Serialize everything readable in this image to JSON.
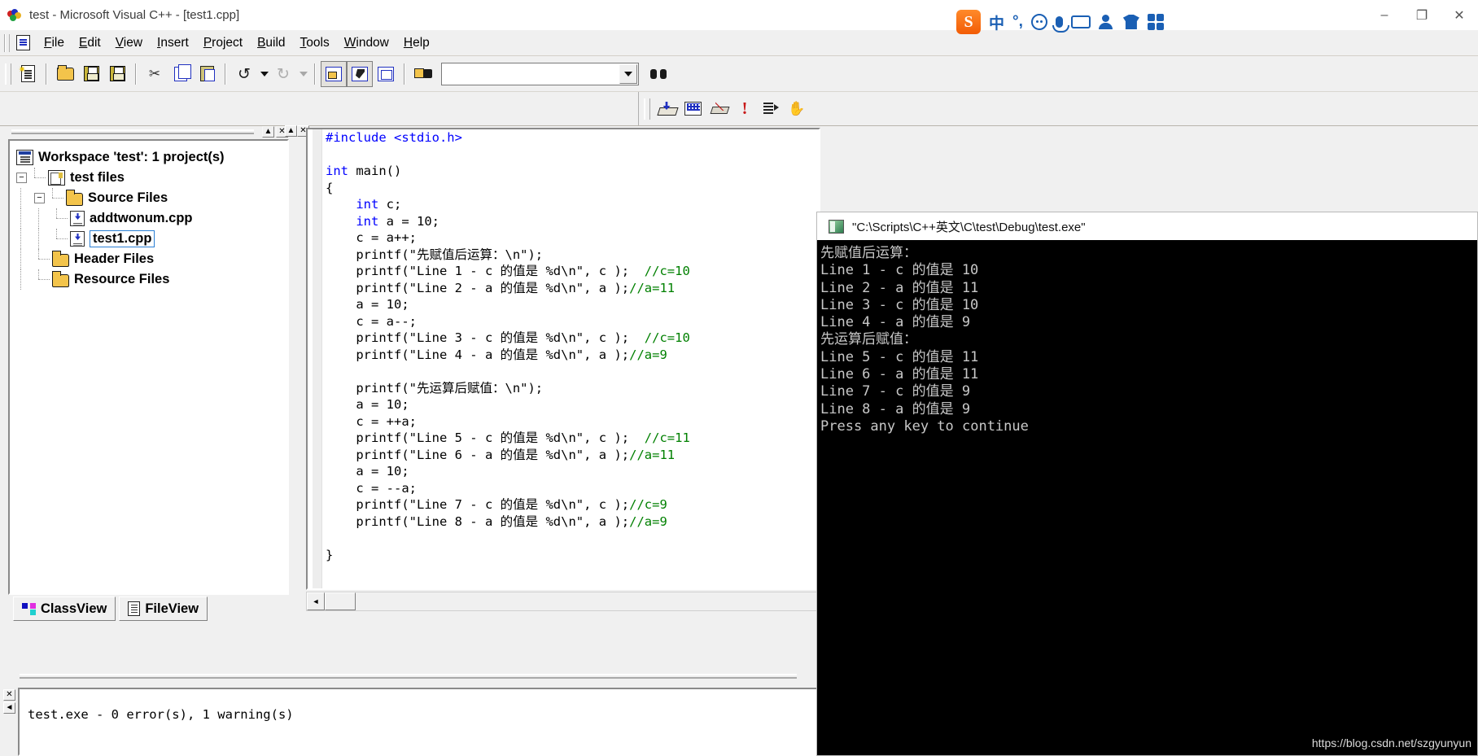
{
  "window": {
    "title": "test - Microsoft Visual C++ - [test1.cpp]",
    "app_icon": "vcpp-logo-icon",
    "minimize": "–",
    "maximize": "❐",
    "close": "✕"
  },
  "ime": {
    "logo": "sogou-ime-logo",
    "lang": "中",
    "punct": "°,",
    "emoji": "emoji-icon",
    "mic": "microphone-icon",
    "keyboard": "keyboard-icon",
    "account": "account-icon",
    "skin": "skin-icon",
    "toolbox": "toolbox-icon"
  },
  "menu": {
    "doc_icon": "document-icon",
    "items": [
      {
        "pre": "",
        "key": "F",
        "post": "ile"
      },
      {
        "pre": "",
        "key": "E",
        "post": "dit"
      },
      {
        "pre": "",
        "key": "V",
        "post": "iew"
      },
      {
        "pre": "",
        "key": "I",
        "post": "nsert"
      },
      {
        "pre": "",
        "key": "P",
        "post": "roject"
      },
      {
        "pre": "",
        "key": "B",
        "post": "uild"
      },
      {
        "pre": "",
        "key": "T",
        "post": "ools"
      },
      {
        "pre": "",
        "key": "W",
        "post": "indow"
      },
      {
        "pre": "",
        "key": "H",
        "post": "elp"
      }
    ]
  },
  "toolbar_standard": {
    "buttons": [
      "new-document-icon",
      "open-folder-icon",
      "save-icon",
      "save-all-icon",
      "cut-scissors-icon",
      "copy-icon",
      "paste-icon",
      "undo-icon",
      "undo-dropdown-icon",
      "redo-icon",
      "redo-dropdown-icon",
      "workspace-window-icon",
      "output-window-icon",
      "resource-window-icon",
      "find-in-files-icon"
    ],
    "find_combo_value": "",
    "find_combo_placeholder": ""
  },
  "toolbar_build": {
    "buttons": [
      "compile-icon",
      "build-icon",
      "stop-build-icon",
      "execute-program-icon",
      "go-debug-icon",
      "insert-breakpoint-icon"
    ]
  },
  "workspace": {
    "caption_restore": "▲",
    "caption_close": "✕",
    "tree": [
      {
        "level": 0,
        "expander": "",
        "icon": "workspace-icon",
        "label": "Workspace 'test': 1 project(s)",
        "selected": false
      },
      {
        "level": 1,
        "expander": "−",
        "icon": "project-icon",
        "label": "test files",
        "selected": false
      },
      {
        "level": 2,
        "expander": "−",
        "icon": "folder-icon",
        "label": "Source Files",
        "selected": false
      },
      {
        "level": 3,
        "expander": "",
        "icon": "cpp-file-icon",
        "label": "addtwonum.cpp",
        "selected": false
      },
      {
        "level": 3,
        "expander": "",
        "icon": "cpp-file-icon",
        "label": "test1.cpp",
        "selected": true
      },
      {
        "level": 2,
        "expander": "",
        "icon": "folder-icon",
        "label": "Header Files",
        "selected": false
      },
      {
        "level": 2,
        "expander": "",
        "icon": "folder-icon",
        "label": "Resource Files",
        "selected": false
      }
    ],
    "tabs": [
      {
        "icon": "class-view-icon",
        "label": "ClassView",
        "active": false
      },
      {
        "icon": "file-view-icon",
        "label": "FileView",
        "active": true
      }
    ]
  },
  "editor": {
    "caption_restore": "▲",
    "caption_close": "✕",
    "scroll_left": "◄",
    "scroll_right": "►",
    "code_lines": [
      [
        {
          "t": "#include <stdio.h>",
          "c": "kw"
        }
      ],
      [],
      [
        {
          "t": "int",
          "c": "kw"
        },
        {
          "t": " main()",
          "c": ""
        }
      ],
      [
        {
          "t": "{",
          "c": ""
        }
      ],
      [
        {
          "t": "    ",
          "c": ""
        },
        {
          "t": "int",
          "c": "kw"
        },
        {
          "t": " c;",
          "c": ""
        }
      ],
      [
        {
          "t": "    ",
          "c": ""
        },
        {
          "t": "int",
          "c": "kw"
        },
        {
          "t": " a = 10;",
          "c": ""
        }
      ],
      [
        {
          "t": "    c = a++;",
          "c": ""
        }
      ],
      [
        {
          "t": "    printf(\"先赋值后运算：\\n\");",
          "c": ""
        }
      ],
      [
        {
          "t": "    printf(\"Line 1 - c 的值是 %d\\n\", c );  ",
          "c": ""
        },
        {
          "t": "//c=10",
          "c": "cm"
        }
      ],
      [
        {
          "t": "    printf(\"Line 2 - a 的值是 %d\\n\", a );",
          "c": ""
        },
        {
          "t": "//a=11",
          "c": "cm"
        }
      ],
      [
        {
          "t": "    a = 10;",
          "c": ""
        }
      ],
      [
        {
          "t": "    c = a--;",
          "c": ""
        }
      ],
      [
        {
          "t": "    printf(\"Line 3 - c 的值是 %d\\n\", c );  ",
          "c": ""
        },
        {
          "t": "//c=10",
          "c": "cm"
        }
      ],
      [
        {
          "t": "    printf(\"Line 4 - a 的值是 %d\\n\", a );",
          "c": ""
        },
        {
          "t": "//a=9",
          "c": "cm"
        }
      ],
      [],
      [
        {
          "t": "    printf(\"先运算后赋值：\\n\");",
          "c": ""
        }
      ],
      [
        {
          "t": "    a = 10;",
          "c": ""
        }
      ],
      [
        {
          "t": "    c = ++a;",
          "c": ""
        }
      ],
      [
        {
          "t": "    printf(\"Line 5 - c 的值是 %d\\n\", c );  ",
          "c": ""
        },
        {
          "t": "//c=11",
          "c": "cm"
        }
      ],
      [
        {
          "t": "    printf(\"Line 6 - a 的值是 %d\\n\", a );",
          "c": ""
        },
        {
          "t": "//a=11",
          "c": "cm"
        }
      ],
      [
        {
          "t": "    a = 10;",
          "c": ""
        }
      ],
      [
        {
          "t": "    c = --a;",
          "c": ""
        }
      ],
      [
        {
          "t": "    printf(\"Line 7 - c 的值是 %d\\n\", c );",
          "c": ""
        },
        {
          "t": "//c=9",
          "c": "cm"
        }
      ],
      [
        {
          "t": "    printf(\"Line 8 - a 的值是 %d\\n\", a );",
          "c": ""
        },
        {
          "t": "//a=9",
          "c": "cm"
        }
      ],
      [],
      [
        {
          "t": "}",
          "c": ""
        }
      ]
    ]
  },
  "output": {
    "caption_close": "✕",
    "caption_scroll": "◄",
    "text": "test.exe - 0 error(s), 1 warning(s)"
  },
  "console": {
    "icon": "console-window-icon",
    "title": "\"C:\\Scripts\\C++英文\\C\\test\\Debug\\test.exe\"",
    "lines": [
      "先赋值后运算：",
      "Line 1 - c 的值是 10",
      "Line 2 - a 的值是 11",
      "Line 3 - c 的值是 10",
      "Line 4 - a 的值是 9",
      "先运算后赋值：",
      "Line 5 - c 的值是 11",
      "Line 6 - a 的值是 11",
      "Line 7 - c 的值是 9",
      "Line 8 - a 的值是 9",
      "Press any key to continue"
    ]
  },
  "watermark": "https://blog.csdn.net/szgyunyun",
  "colors": {
    "keyword": "#0000ff",
    "comment": "#008000",
    "console_bg": "#000000",
    "console_fg": "#c8c8c8",
    "selection_border": "#2a7fd4"
  }
}
